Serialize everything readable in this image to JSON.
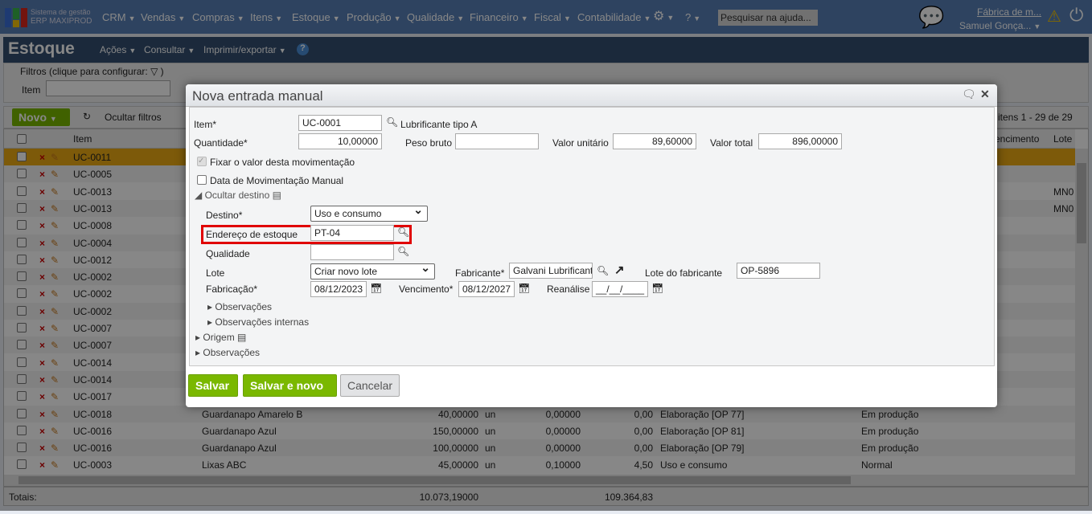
{
  "topbar": {
    "logo_line1": "Sistema de gestão",
    "logo_line2": "ERP MAXIPROD",
    "menus": [
      "CRM",
      "Vendas",
      "Compras",
      "Itens",
      "Estoque",
      "Produção",
      "Qualidade",
      "Financeiro",
      "Fiscal",
      "Contabilidade"
    ],
    "search_placeholder": "Pesquisar na ajuda...",
    "company": "Fábrica de m...",
    "user": "Samuel Gonça..."
  },
  "page": {
    "title": "Estoque",
    "menus": [
      "Ações",
      "Consultar",
      "Imprimir/exportar"
    ]
  },
  "filters": {
    "legend": "Filtros (clique para configurar:",
    "item_label": "Item"
  },
  "toolbar": {
    "new": "Novo",
    "hide_filters": "Ocultar filtros",
    "pagination": "itens 1 - 29 de 29"
  },
  "grid": {
    "headers": {
      "item": "Item",
      "vencimento": "encimento",
      "lote": "Lote"
    },
    "rows": [
      {
        "item": "UC-0011"
      },
      {
        "item": "UC-0005"
      },
      {
        "item": "UC-0013",
        "lote": "MN0"
      },
      {
        "item": "UC-0013",
        "lote": "MN0"
      },
      {
        "item": "UC-0008"
      },
      {
        "item": "UC-0004"
      },
      {
        "item": "UC-0012"
      },
      {
        "item": "UC-0002"
      },
      {
        "item": "UC-0002"
      },
      {
        "item": "UC-0002"
      },
      {
        "item": "UC-0007"
      },
      {
        "item": "UC-0007"
      },
      {
        "item": "UC-0014"
      },
      {
        "item": "UC-0014"
      },
      {
        "item": "UC-0017"
      },
      {
        "item": "UC-0018",
        "desc": "Guardanapo Amarelo B",
        "qty": "40,00000",
        "unit": "un",
        "vu": "0,00000",
        "total": "0,00",
        "dest": "Elaboração [OP 77]",
        "status": "Em produção"
      },
      {
        "item": "UC-0016",
        "desc": "Guardanapo Azul",
        "qty": "150,00000",
        "unit": "un",
        "vu": "0,00000",
        "total": "0,00",
        "dest": "Elaboração [OP 81]",
        "status": "Em produção"
      },
      {
        "item": "UC-0016",
        "desc": "Guardanapo Azul",
        "qty": "100,00000",
        "unit": "un",
        "vu": "0,00000",
        "total": "0,00",
        "dest": "Elaboração [OP 79]",
        "status": "Em produção"
      },
      {
        "item": "UC-0003",
        "desc": "Lixas ABC",
        "qty": "45,00000",
        "unit": "un",
        "vu": "0,10000",
        "total": "4,50",
        "dest": "Uso e consumo",
        "status": "Normal"
      }
    ],
    "totals": {
      "label": "Totais:",
      "qty": "10.073,19000",
      "total": "109.364,83"
    }
  },
  "dialog": {
    "title": "Nova entrada manual",
    "item_label": "Item*",
    "item_value": "UC-0001",
    "item_desc": "Lubrificante tipo A",
    "qty_label": "Quantidade*",
    "qty_value": "10,00000",
    "peso_label": "Peso bruto",
    "peso_value": "",
    "vu_label": "Valor unitário",
    "vu_value": "89,60000",
    "vt_label": "Valor total",
    "vt_value": "896,00000",
    "fix_label": "Fixar o valor desta movimentação",
    "manual_date_label": "Data de Movimentação Manual",
    "hide_dest": "Ocultar destino",
    "destino_label": "Destino*",
    "destino_value": "Uso e consumo",
    "endereco_label": "Endereço de estoque",
    "endereco_value": "PT-04",
    "qualidade_label": "Qualidade",
    "qualidade_value": "",
    "lote_label": "Lote",
    "lote_value": "Criar novo lote",
    "fabricante_label": "Fabricante*",
    "fabricante_value": "Galvani Lubrificant",
    "lote_fab_label": "Lote do fabricante",
    "lote_fab_value": "OP-5896",
    "fabricacao_label": "Fabricação*",
    "fabricacao_value": "08/12/2023",
    "venc_label": "Vencimento*",
    "venc_value": "08/12/2027",
    "reanalise_label": "Reanálise",
    "reanalise_value": "__/__/____",
    "obs": "Observações",
    "obs_int": "Observações internas",
    "origem": "Origem",
    "obs2": "Observações",
    "save": "Salvar",
    "save_new": "Salvar e novo",
    "cancel": "Cancelar"
  },
  "colors": {
    "accent_green": "#7ab800",
    "highlight_red": "#e00000"
  }
}
